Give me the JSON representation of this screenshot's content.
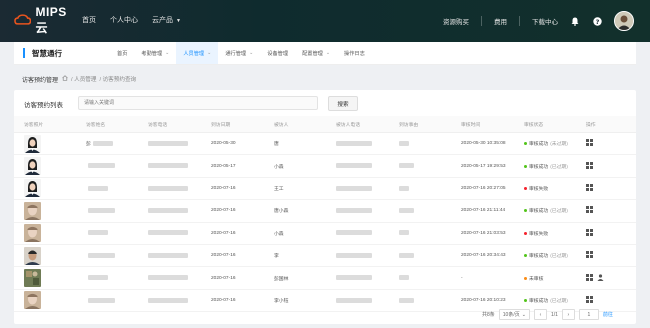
{
  "app": {
    "logo_text": "MIPS云",
    "brand_color": "#e8541e"
  },
  "topnav": {
    "items": [
      {
        "label": "首页"
      },
      {
        "label": "个人中心"
      },
      {
        "label": "云产品"
      }
    ],
    "right": {
      "resource_purchase": "资源购买",
      "fees": "费用",
      "download_center": "下载中心"
    }
  },
  "module": {
    "title": "智慧通行",
    "nav": [
      {
        "label": "首页"
      },
      {
        "label": "考勤管理"
      },
      {
        "label": "人员管理"
      },
      {
        "label": "通行管理"
      },
      {
        "label": "设备管理"
      },
      {
        "label": "配置管理"
      },
      {
        "label": "操作日志"
      }
    ]
  },
  "breadcrumb": {
    "title": "访客预约管理",
    "path": [
      "/ 人员管理",
      "/ 访客预约查询"
    ]
  },
  "list": {
    "title": "访客预约列表",
    "search_placeholder": "请输入关键词",
    "search_button": "搜索"
  },
  "table": {
    "columns": [
      "访客照片",
      "访客姓名",
      "访客电话",
      "到访日期",
      "被访人",
      "被访人电话",
      "到访事由",
      "审核时间",
      "审核状态",
      "操作"
    ],
    "rows": [
      {
        "name": "彭",
        "date": "2020-05-30",
        "host": "唐",
        "review_time": "2020-05-30 10:35:08",
        "status": "审核成功",
        "status_note": "(未过期)",
        "status_color": "#52c41a",
        "photo": "f"
      },
      {
        "name": "",
        "date": "2020-05-17",
        "host": "小森",
        "review_time": "2020-05-17 19:29:53",
        "status": "审核成功",
        "status_note": "(已过期)",
        "status_color": "#52c41a",
        "photo": "f"
      },
      {
        "name": "",
        "date": "2020-07-16",
        "host": "王工",
        "review_time": "2020-07-16 20:27:05",
        "status": "审核失败",
        "status_note": "",
        "status_color": "#f5222d",
        "photo": "f"
      },
      {
        "name": "",
        "date": "2020-07-16",
        "host": "唐小森",
        "review_time": "2020-07-16 21:11:44",
        "status": "审核成功",
        "status_note": "(已过期)",
        "status_color": "#52c41a",
        "photo": "m"
      },
      {
        "name": "",
        "date": "2020-07-16",
        "host": "小森",
        "review_time": "2020-07-16 21:03:53",
        "status": "审核失败",
        "status_note": "",
        "status_color": "#f5222d",
        "photo": "m"
      },
      {
        "name": "",
        "date": "2020-07-16",
        "host": "李",
        "review_time": "2020-07-16 20:34:43",
        "status": "审核成功",
        "status_note": "(已过期)",
        "status_color": "#52c41a",
        "photo": "m2"
      },
      {
        "name": "",
        "date": "2020-07-16",
        "host": "彭国林",
        "review_time": "-",
        "status": "未审核",
        "status_note": "",
        "status_color": "#fa8c16",
        "photo": "p"
      },
      {
        "name": "",
        "date": "2020-07-16",
        "host": "李小钰",
        "review_time": "2020-07-16 20:10:23",
        "status": "审核成功",
        "status_note": "(已过期)",
        "status_color": "#52c41a",
        "photo": "m"
      }
    ]
  },
  "pager": {
    "total": "共8条",
    "page_size": "10条/页",
    "page_info": "1/1",
    "current_page": "1",
    "goto": "前往"
  }
}
